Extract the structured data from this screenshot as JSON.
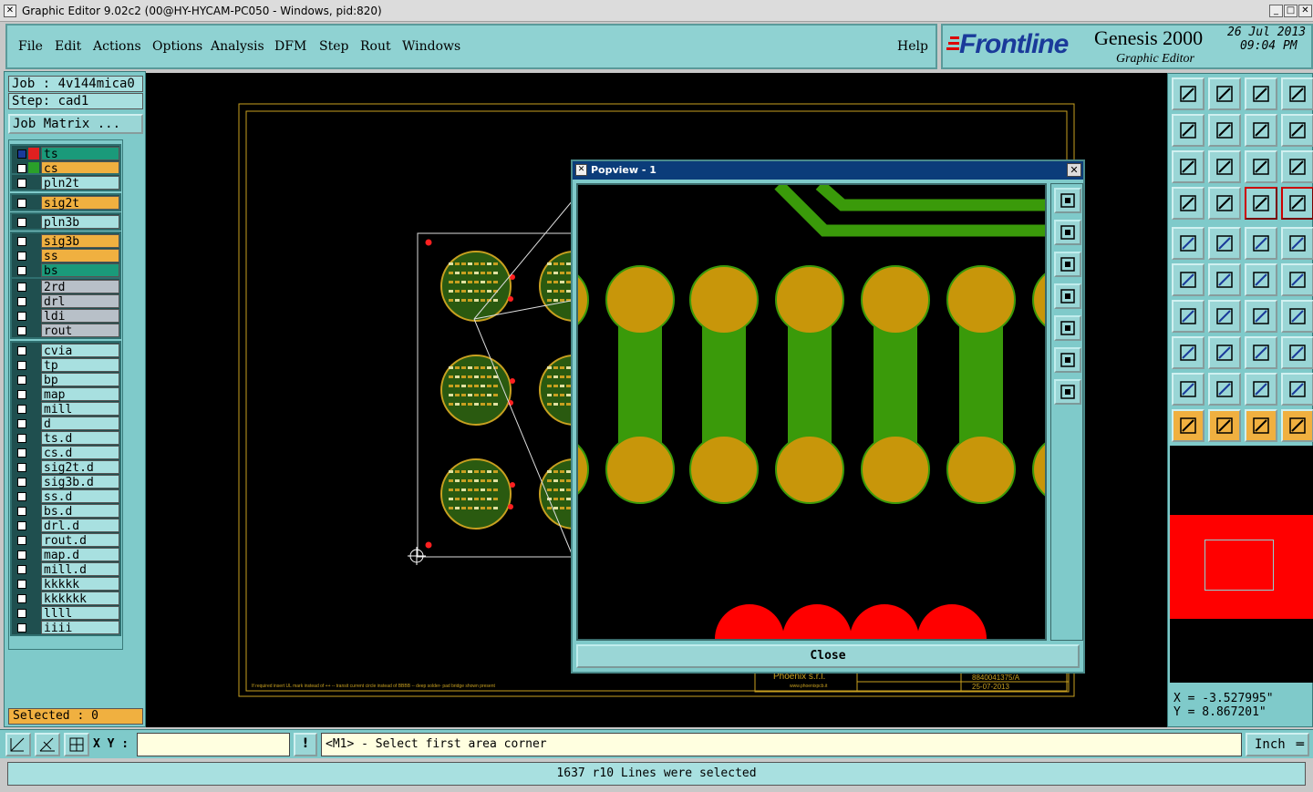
{
  "window": {
    "title": "Graphic Editor 9.02c2 (00@HY-HYCAM-PC050 - Windows, pid:820)"
  },
  "menu": {
    "items": [
      "File",
      "Edit",
      "Actions",
      "Options",
      "Analysis",
      "DFM",
      "Step",
      "Rout",
      "Windows"
    ],
    "help": "Help"
  },
  "brand": {
    "logo": "Frontline",
    "product": "Genesis 2000",
    "subtitle": "Graphic Editor",
    "date": "26 Jul 2013",
    "time": "09:04 PM"
  },
  "job": {
    "job_label": "Job : 4v144mica0",
    "step_label": "Step: cad1",
    "matrix_button": "Job Matrix ..."
  },
  "layers": [
    {
      "name": "ts",
      "color": "#1a9a7a",
      "swatch": "#e02020",
      "affected": true
    },
    {
      "name": "cs",
      "color": "#f0b040",
      "swatch": "#2aa02a"
    },
    {
      "name": "pln2t",
      "color": "#a8e0e0"
    },
    {
      "name": "sig2t",
      "color": "#f0b040"
    },
    {
      "name": "pln3b",
      "color": "#a8e0e0"
    },
    {
      "name": "sig3b",
      "color": "#f0b040"
    },
    {
      "name": "ss",
      "color": "#f0b040"
    },
    {
      "name": "bs",
      "color": "#1a9a7a"
    },
    {
      "name": "2rd",
      "color": "#b8c0c8"
    },
    {
      "name": "drl",
      "color": "#b8c0c8"
    },
    {
      "name": "ldi",
      "color": "#b8c0c8"
    },
    {
      "name": "rout",
      "color": "#b8c0c8"
    },
    {
      "name": "cvia",
      "color": "#a8e0e0"
    },
    {
      "name": "tp",
      "color": "#a8e0e0"
    },
    {
      "name": "bp",
      "color": "#a8e0e0"
    },
    {
      "name": "map",
      "color": "#a8e0e0"
    },
    {
      "name": "mill",
      "color": "#a8e0e0"
    },
    {
      "name": "d",
      "color": "#a8e0e0"
    },
    {
      "name": "ts.d",
      "color": "#a8e0e0"
    },
    {
      "name": "cs.d",
      "color": "#a8e0e0"
    },
    {
      "name": "sig2t.d",
      "color": "#a8e0e0"
    },
    {
      "name": "sig3b.d",
      "color": "#a8e0e0"
    },
    {
      "name": "ss.d",
      "color": "#a8e0e0"
    },
    {
      "name": "bs.d",
      "color": "#a8e0e0"
    },
    {
      "name": "drl.d",
      "color": "#a8e0e0"
    },
    {
      "name": "rout.d",
      "color": "#a8e0e0"
    },
    {
      "name": "map.d",
      "color": "#a8e0e0"
    },
    {
      "name": "mill.d",
      "color": "#a8e0e0"
    },
    {
      "name": "kkkkk",
      "color": "#a8e0e0"
    },
    {
      "name": "kkkkkk",
      "color": "#a8e0e0"
    },
    {
      "name": "llll",
      "color": "#a8e0e0"
    },
    {
      "name": "iiii",
      "color": "#a8e0e0"
    }
  ],
  "selected": "Selected : 0",
  "canvas": {
    "title_block_company": "Phoenix s.r.l.",
    "title_block_site": "www.phoenixpcb.it",
    "part_number": "8840041375/A",
    "date": "25-07-2013",
    "footer_note": "If required insert UL  mark instead of ++  -- transit current circle instead of BBBB -- deep solder- pad bridge shown present"
  },
  "popview": {
    "title": "Popview - 1",
    "close_label": "Close"
  },
  "coords": {
    "x": "X = -3.527995\"",
    "y": "Y = 8.867201\""
  },
  "command": {
    "xy_label": "X Y :",
    "input_value": "",
    "prompt": "<M1> - Select first area corner",
    "units": "Inch"
  },
  "status": "1637 r10 Lines were selected",
  "colors": {
    "panel": "#7fcaca",
    "signal_pad": "#c8960a",
    "trace": "#3a9a0a",
    "mask": "#ff0000"
  },
  "icons": [
    "home-icon",
    "move-icon",
    "window-icon",
    "zoom-fit-icon",
    "help-icon",
    "select-icon"
  ]
}
